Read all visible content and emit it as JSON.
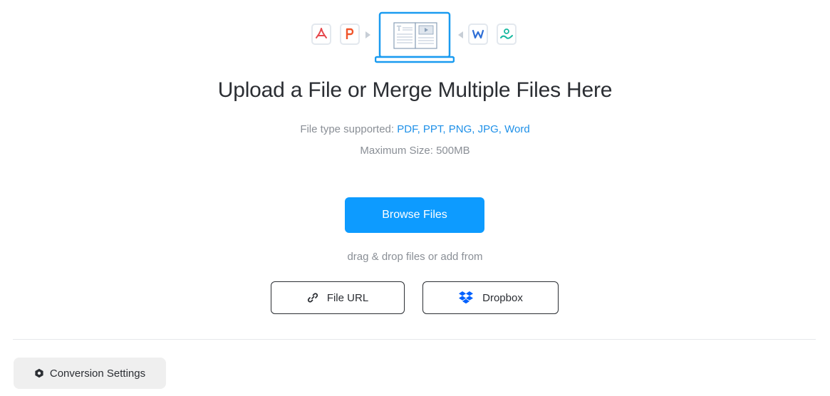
{
  "hero": {
    "icons": [
      "pdf-file-icon",
      "ppt-file-icon",
      "laptop-document-icon",
      "word-file-icon",
      "image-file-icon"
    ]
  },
  "upload": {
    "headline": "Upload a File or Merge Multiple Files Here",
    "supported_prefix": "File type supported: ",
    "supported_types": "PDF, PPT, PNG, JPG, Word",
    "max_size": "Maximum Size: 500MB",
    "browse_label": "Browse Files",
    "dragdrop_text": "drag & drop files or add from"
  },
  "sources": {
    "url_label": "File URL",
    "dropbox_label": "Dropbox"
  },
  "settings": {
    "label": "Conversion Settings"
  },
  "colors": {
    "accent": "#0d9bff",
    "link": "#1e90e8",
    "muted_text": "#8a8f96",
    "heading": "#2b2e33",
    "dropbox": "#0061fe"
  }
}
